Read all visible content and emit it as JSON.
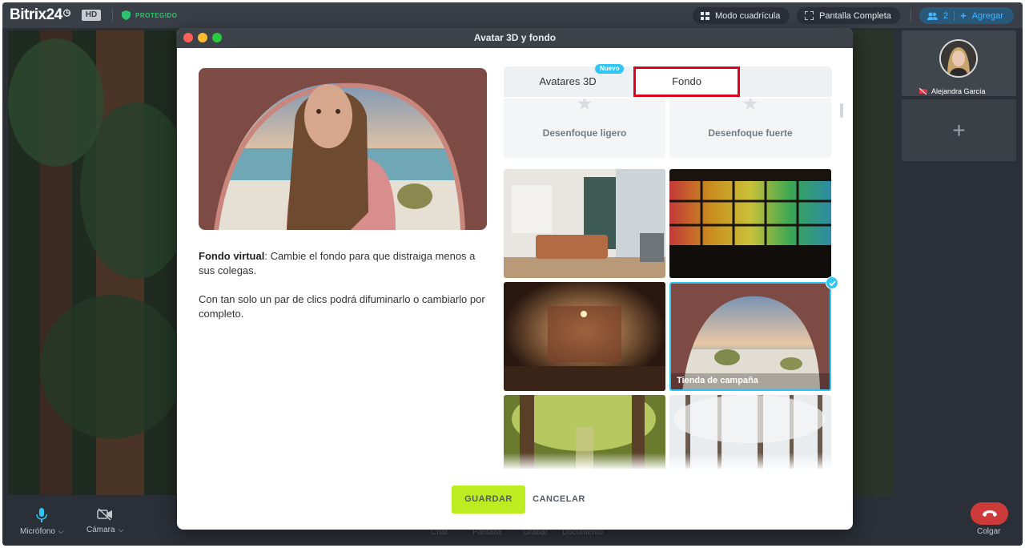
{
  "header": {
    "brand": "Bitrix24",
    "brand_clock": "Ⓞ",
    "hd_badge": "HD",
    "protected": "PROTEGIDO",
    "grid_mode": "Modo cuadrícula",
    "fullscreen": "Pantalla Completa",
    "participants_count": "2",
    "add_label": "Agregar"
  },
  "participant": {
    "name": "Alejandra García"
  },
  "dialog": {
    "title": "Avatar 3D y fondo",
    "tabs": [
      {
        "label": "Avatares 3D",
        "badge": "Nuevo"
      },
      {
        "label": "Fondo"
      }
    ],
    "description_bold": "Fondo virtual",
    "description_rest": ": Cambie el fondo para que distraiga menos a sus colegas.",
    "description_2": "Con tan solo un par de clics podrá difuminarlo o cambiarlo por completo.",
    "backgrounds": [
      {
        "label": "Desenfoque ligero"
      },
      {
        "label": "Desenfoque fuerte"
      },
      {
        "label": ""
      },
      {
        "label": ""
      },
      {
        "label": ""
      },
      {
        "label": "Tienda de campaña",
        "selected": true
      },
      {
        "label": ""
      },
      {
        "label": ""
      }
    ],
    "save_label": "GUARDAR",
    "cancel_label": "CANCELAR"
  },
  "controls": {
    "microphone": "Micrófono",
    "camera": "Cámara",
    "chat": "Chat",
    "screen": "Pantalla",
    "record": "Grabar",
    "document": "Documento",
    "hangup": "Colgar"
  },
  "colors": {
    "accent_green": "#bbed21",
    "active_tab_border": "#e0001b",
    "selected_blue": "#2fc6f6",
    "hangup_red": "#cc3b3a"
  }
}
